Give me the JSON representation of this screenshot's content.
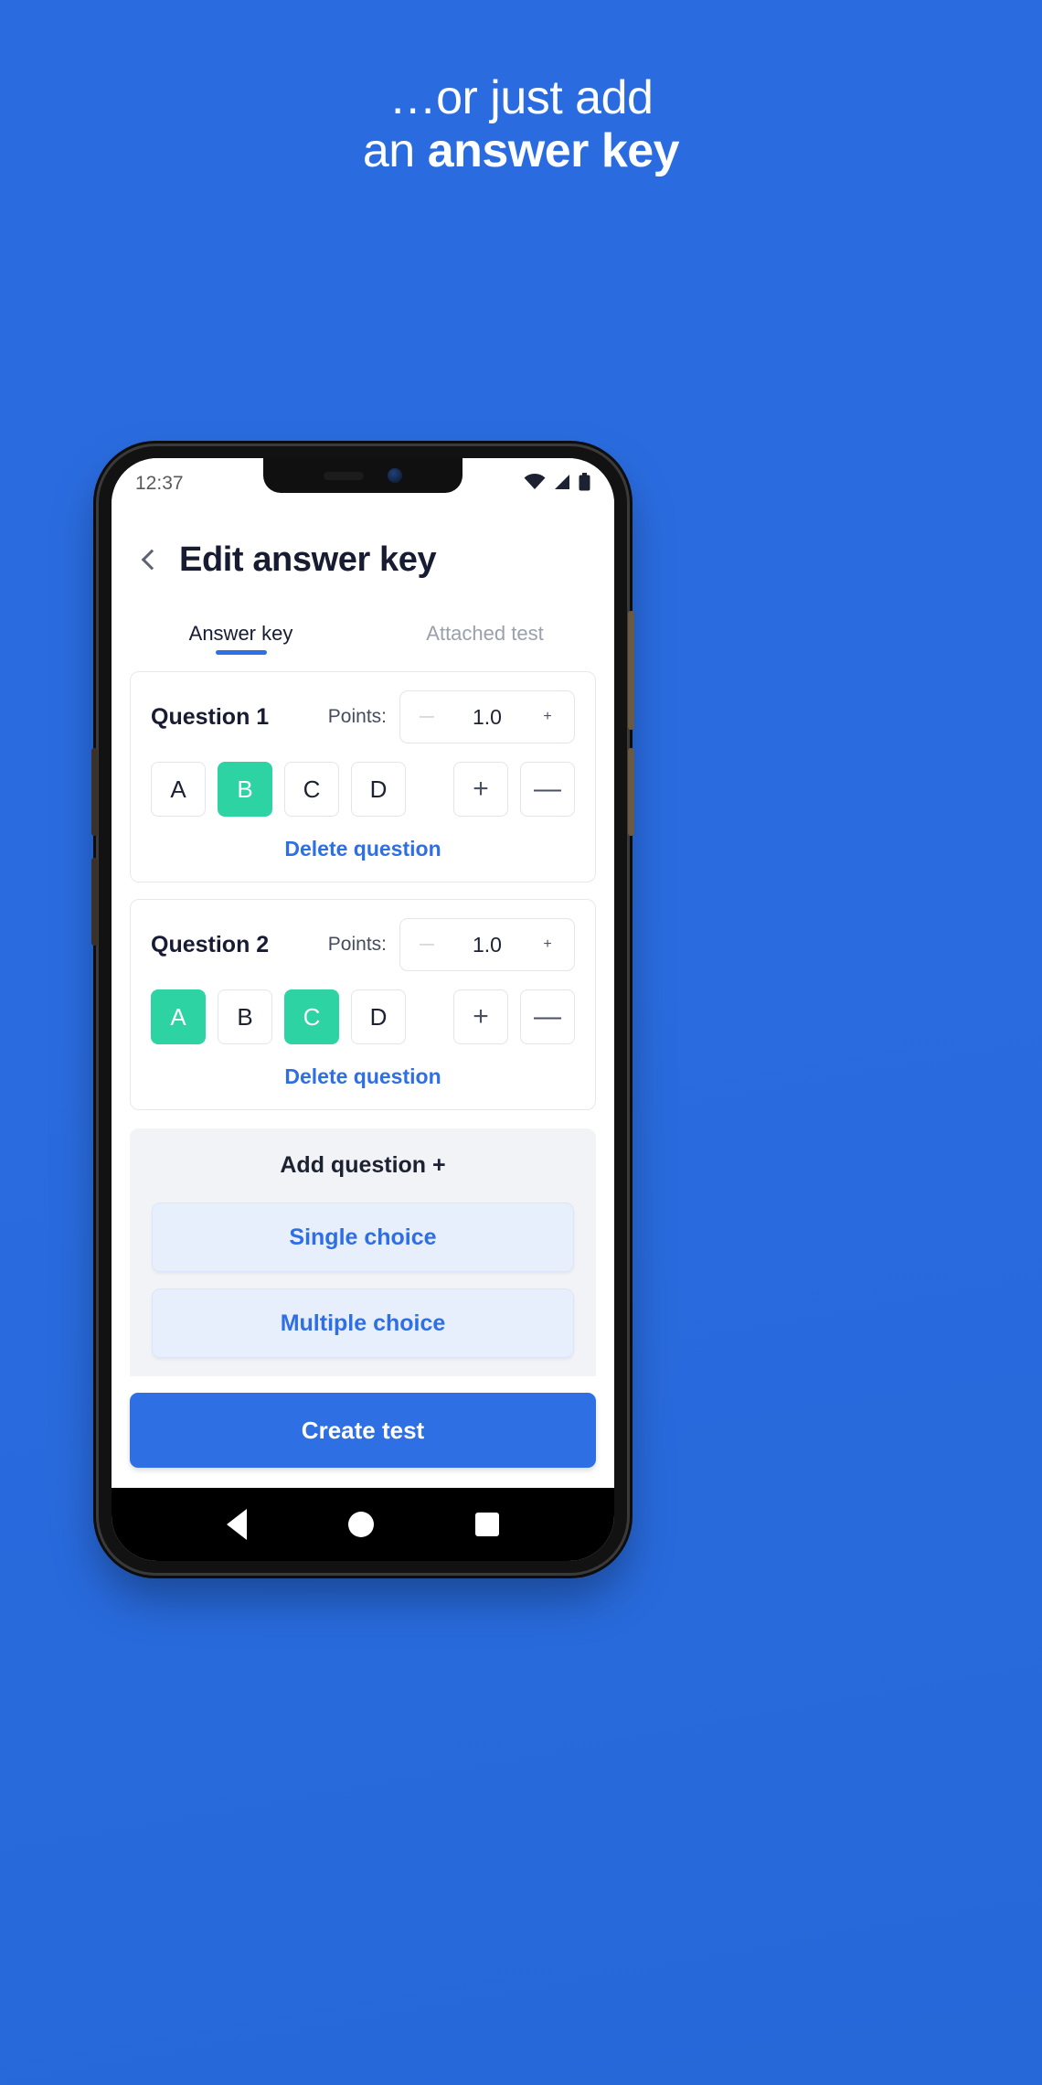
{
  "promo": {
    "line1": "…or just add",
    "line2_prefix": "an ",
    "line2_bold": "answer key",
    "bg_color": "#2a6ce0"
  },
  "statusbar": {
    "time": "12:37",
    "icons": [
      "wifi-icon",
      "cellular-signal-icon",
      "battery-icon"
    ]
  },
  "header": {
    "back_label": "back-chevron",
    "title": "Edit answer key"
  },
  "tabs": [
    {
      "label": "Answer key",
      "active": true
    },
    {
      "label": "Attached test",
      "active": false
    }
  ],
  "questions": [
    {
      "title": "Question 1",
      "points_label": "Points:",
      "points_value": "1.0",
      "minus_glyph": "—",
      "plus_glyph": "+",
      "options": [
        {
          "label": "A",
          "selected": false
        },
        {
          "label": "B",
          "selected": true
        },
        {
          "label": "C",
          "selected": false
        },
        {
          "label": "D",
          "selected": false
        }
      ],
      "add_option_glyph": "+",
      "remove_option_glyph": "—",
      "delete_label": "Delete question"
    },
    {
      "title": "Question 2",
      "points_label": "Points:",
      "points_value": "1.0",
      "minus_glyph": "—",
      "plus_glyph": "+",
      "options": [
        {
          "label": "A",
          "selected": true
        },
        {
          "label": "B",
          "selected": false
        },
        {
          "label": "C",
          "selected": true
        },
        {
          "label": "D",
          "selected": false
        }
      ],
      "add_option_glyph": "+",
      "remove_option_glyph": "—",
      "delete_label": "Delete question"
    }
  ],
  "add_panel": {
    "title": "Add question +",
    "single_choice": "Single choice",
    "multiple_choice": "Multiple choice"
  },
  "cta": {
    "label": "Create test"
  },
  "navbar": {
    "back": "nav-back-icon",
    "home": "nav-home-icon",
    "recents": "nav-recents-icon"
  },
  "colors": {
    "brand_blue": "#2f6fe4",
    "selected_green": "#2ed3a4",
    "title_dark": "#181c32",
    "muted_gray": "#9aa0ac"
  }
}
